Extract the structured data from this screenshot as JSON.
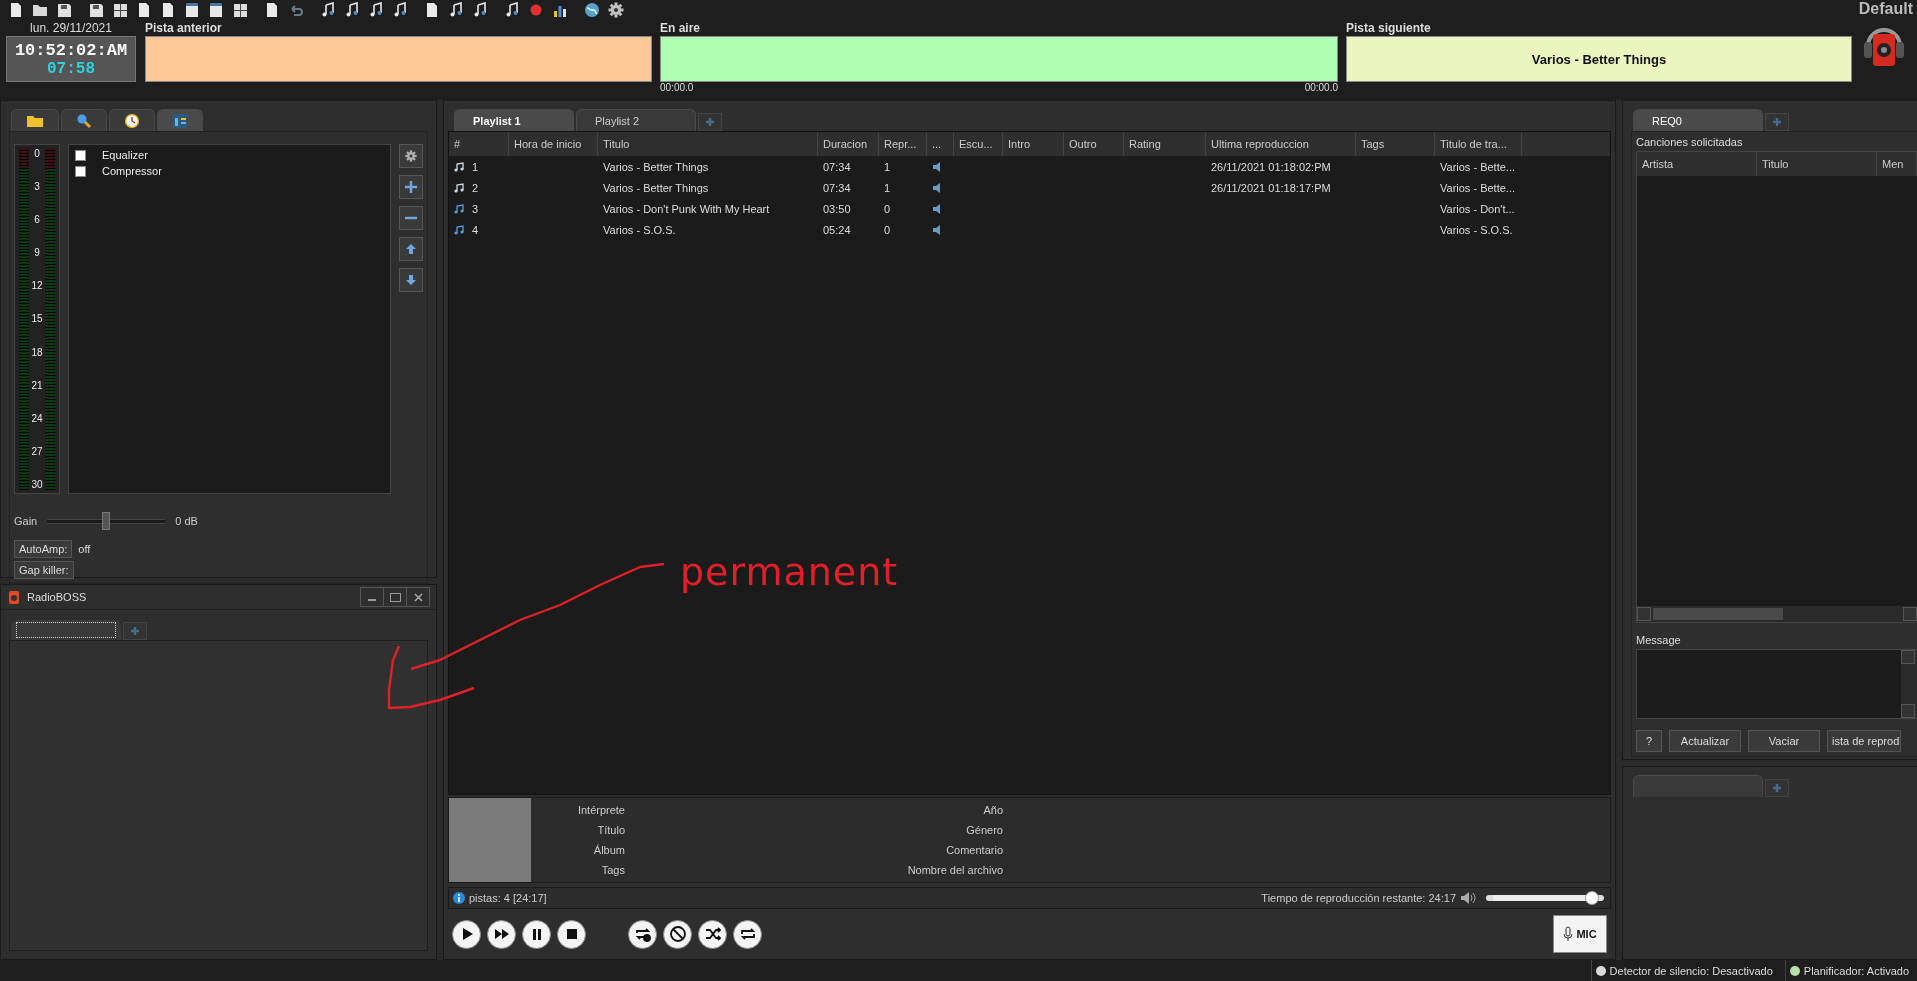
{
  "profile": "Default",
  "clock": {
    "date": "lun. 29/11/2021",
    "time": "10:52:02:AM",
    "countdown": "07:58"
  },
  "decks": [
    {
      "label": "Pista anterior",
      "color": "#ffc896"
    },
    {
      "label": "En aire",
      "color": "#b0ffb0",
      "elapsed": "00:00.0",
      "remaining": "00:00.0"
    },
    {
      "label": "Pista siguiente",
      "color": "#eaf5c0",
      "track": "Varios - Better Things"
    }
  ],
  "left_panel": {
    "tabs": [
      {
        "kind": "folder",
        "selected": false
      },
      {
        "kind": "search",
        "selected": false
      },
      {
        "kind": "clock",
        "selected": false
      },
      {
        "kind": "effects",
        "selected": true
      }
    ],
    "meter_scale": [
      "0",
      "3",
      "6",
      "9",
      "12",
      "15",
      "18",
      "21",
      "24",
      "27",
      "30"
    ],
    "effects": [
      {
        "label": "Equalizer",
        "checked": false
      },
      {
        "label": "Compressor",
        "checked": false
      }
    ],
    "side_buttons": [
      {
        "kind": "settings"
      },
      {
        "kind": "add"
      },
      {
        "kind": "remove"
      },
      {
        "kind": "up"
      },
      {
        "kind": "down"
      }
    ],
    "gain": {
      "label": "Gain",
      "level": 0.5,
      "reading": "0 dB"
    },
    "autoamp": {
      "button": "AutoAmp:",
      "value": "off"
    },
    "gap_killer": {
      "button": "Gap killer:"
    }
  },
  "float_window": {
    "title": "RadioBOSS"
  },
  "playlist": {
    "tabs": [
      {
        "label": "Playlist 1",
        "selected": true
      },
      {
        "label": "Playlist 2",
        "selected": false
      }
    ],
    "columns": [
      "#",
      "Hora de inicio",
      "Titulo",
      "Duracion",
      "Repr...",
      "...",
      "Escu...",
      "Intro",
      "Outro",
      "Rating",
      "Ultima reproduccion",
      "Tags",
      "Titulo de tra..."
    ],
    "rows": [
      {
        "number": "1",
        "title": "Varios - Better Things",
        "duration": "07:34",
        "plays": "1",
        "last_played": "26/11/2021 01:18:02:PM",
        "track_title": "Varios - Bette...",
        "played": true
      },
      {
        "number": "2",
        "title": "Varios - Better Things",
        "duration": "07:34",
        "plays": "1",
        "last_played": "26/11/2021 01:18:17:PM",
        "track_title": "Varios - Bette...",
        "played": true
      },
      {
        "number": "3",
        "title": "Varios - Don't Punk With My Heart",
        "duration": "03:50",
        "plays": "0",
        "track_title": "Varios - Don't...",
        "played": false
      },
      {
        "number": "4",
        "title": "Varios - S.O.S.",
        "duration": "05:24",
        "plays": "0",
        "track_title": "Varios - S.O.S.",
        "played": false
      }
    ]
  },
  "track_info": {
    "left_fields": [
      "Intérprete",
      "Título",
      "Álbum",
      "Tags"
    ],
    "right_fields": [
      "Año",
      "Género",
      "Comentario",
      "Nombre del archivo"
    ]
  },
  "playlist_status": {
    "tracks": "pistas: 4 [24:17]",
    "remaining": "Tiempo de reproducción restante: 24:17",
    "volume": {
      "level": 0.95
    }
  },
  "transport": [
    {
      "kind": "play"
    },
    {
      "kind": "next"
    },
    {
      "kind": "pause"
    },
    {
      "kind": "stop"
    },
    {
      "kind": "repeat-one"
    },
    {
      "kind": "disabled"
    },
    {
      "kind": "shuffle"
    },
    {
      "kind": "repeat"
    }
  ],
  "mic_button": "MIC",
  "requests": {
    "tab": "REQ0",
    "heading": "Canciones solicitadas",
    "columns": [
      "Artista",
      "Titulo",
      "Men"
    ],
    "message_label": "Message",
    "buttons": [
      "?",
      "Actualizar",
      "Vaciar",
      "ista de reprod"
    ]
  },
  "status_bar": [
    {
      "label": "Detector de silencio: Desactivado",
      "on": false
    },
    {
      "label": "Planificador: Activado",
      "on": true
    }
  ],
  "annotation": {
    "text": "permanent"
  }
}
